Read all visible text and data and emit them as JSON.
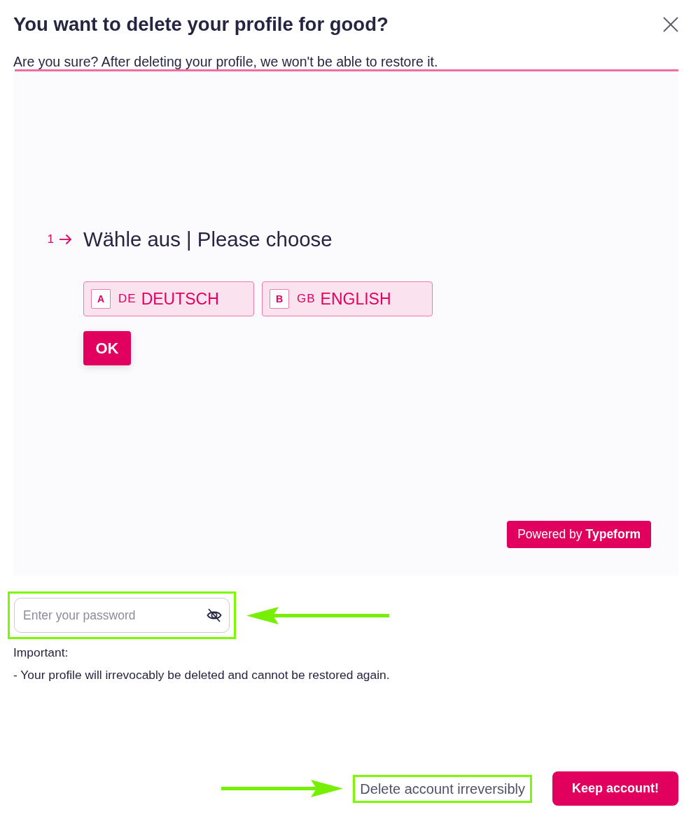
{
  "dialog": {
    "title": "You want to delete your profile for good?",
    "subtitle": "Are you sure? After deleting your profile, we won't be able to restore it."
  },
  "form": {
    "question": {
      "number": "1",
      "text": "Wähle aus | Please choose"
    },
    "choices": [
      {
        "key": "A",
        "flag": "DE",
        "label": "DEUTSCH",
        "selected": false
      },
      {
        "key": "B",
        "flag": "GB",
        "label": "ENGLISH",
        "selected": false
      }
    ],
    "submit": "OK",
    "badge": "Powered by **Typeform**"
  },
  "password_field": {
    "placeholder": "Enter your password",
    "highlighted": true
  },
  "notice": {
    "heading": "Important:",
    "lines": [
      "- Your profile will irrevocably be deleted and cannot be restored again."
    ]
  },
  "actions": [
    {
      "kind": "link",
      "label": "Delete account irreversibly",
      "highlighted": true
    },
    {
      "kind": "primary",
      "label": "Keep account!",
      "highlighted": false
    }
  ]
}
